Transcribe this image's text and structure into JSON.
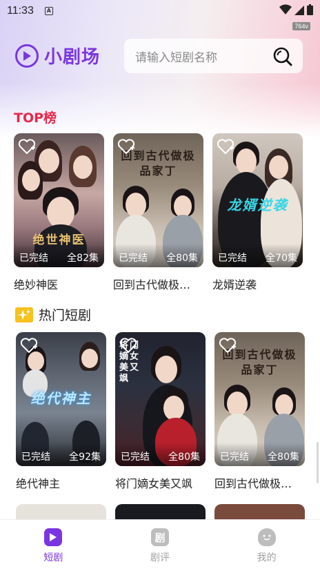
{
  "status": {
    "time": "11:33",
    "network": "764v"
  },
  "app": {
    "name": "小剧场",
    "accent": "#7b35e0"
  },
  "search": {
    "placeholder": "请输入短剧名称"
  },
  "sections": {
    "top": {
      "title": "TOP榜"
    },
    "hot": {
      "title": "热门短剧"
    }
  },
  "top_dramas": [
    {
      "title": "绝妙神医",
      "status": "已完结",
      "episodes": "全82集",
      "poster_text": "绝世神医"
    },
    {
      "title": "回到古代做极…",
      "status": "已完结",
      "episodes": "全80集",
      "poster_text": "回到古代做极品家丁"
    },
    {
      "title": "龙婿逆袭",
      "status": "已完结",
      "episodes": "全70集",
      "poster_text": "龙婿逆袭"
    }
  ],
  "hot_dramas": [
    {
      "title": "绝代神主",
      "status": "已完结",
      "episodes": "全92集",
      "poster_text": "绝代神主"
    },
    {
      "title": "将门嫡女美又飒",
      "status": "已完结",
      "episodes": "全80集",
      "poster_text": "将门嫡女美又飒"
    },
    {
      "title": "回到古代做极…",
      "status": "已完结",
      "episodes": "全80集",
      "poster_text": "回到古代做极品家丁"
    }
  ],
  "nav": [
    {
      "label": "短剧",
      "icon": "play-icon",
      "active": true
    },
    {
      "label": "剧评",
      "icon": "review-icon",
      "active": false
    },
    {
      "label": "我的",
      "icon": "profile-icon",
      "active": false
    }
  ]
}
